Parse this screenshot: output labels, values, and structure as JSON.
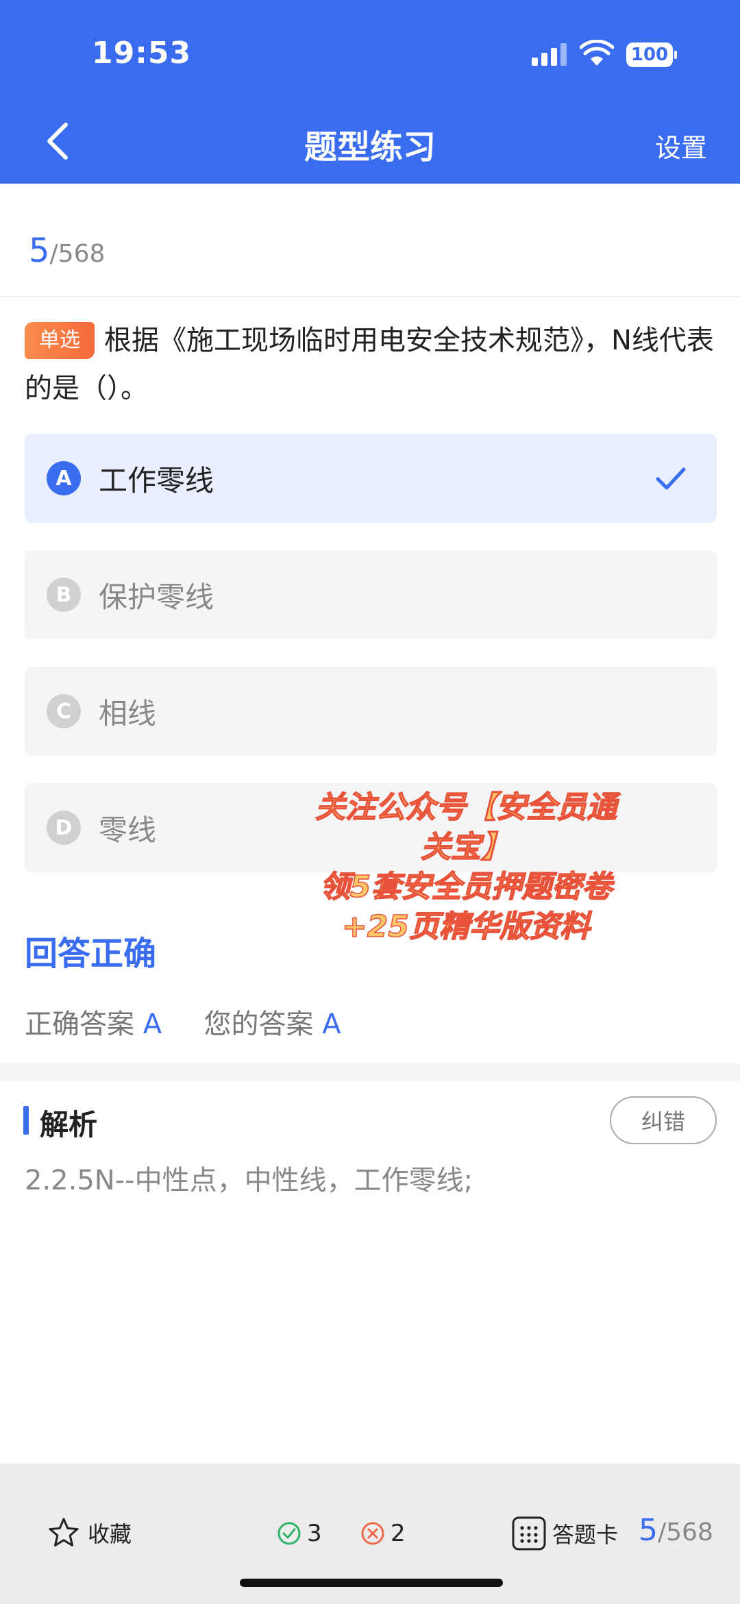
{
  "status_bar": {
    "time": "19:53",
    "battery": "100"
  },
  "nav": {
    "title": "题型练习",
    "settings": "设置"
  },
  "progress": {
    "current": "5",
    "total": "/568"
  },
  "question": {
    "type": "单选",
    "text": "根据《施工现场临时用电安全技术规范》，N线代表的是（）。"
  },
  "options": [
    {
      "letter": "A",
      "text": "工作零线",
      "selected": true
    },
    {
      "letter": "B",
      "text": "保护零线",
      "selected": false
    },
    {
      "letter": "C",
      "text": "相线",
      "selected": false
    },
    {
      "letter": "D",
      "text": "零线",
      "selected": false
    }
  ],
  "result": {
    "title": "回答正确",
    "correct_label": "正确答案",
    "correct_value": "A",
    "your_label": "您的答案",
    "your_value": "A"
  },
  "analysis": {
    "title": "解析",
    "report_button": "纠错",
    "text": "2.2.5N--中性点，中性线，工作零线;"
  },
  "watermark": {
    "line1": "关注公众号【安全员通",
    "line2": "关宝】",
    "line3": "领5套安全员押题密卷",
    "line4": "+25页精华版资料"
  },
  "bottom_bar": {
    "favorite": "收藏",
    "correct_count": "3",
    "wrong_count": "2",
    "answer_card": "答题卡",
    "current": "5",
    "total": "/568"
  },
  "colors": {
    "primary": "#3a6cf0",
    "correct": "#2fb36b",
    "wrong": "#f06a4a"
  }
}
